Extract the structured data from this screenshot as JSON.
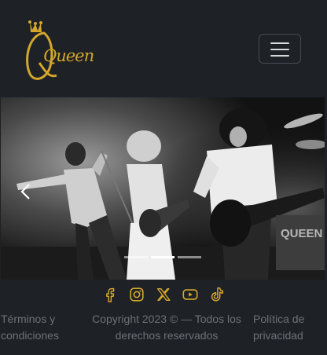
{
  "brand": {
    "logo_text": "Queen",
    "logo_color": "#d4a72c"
  },
  "navbar": {
    "toggler_icon": "hamburger-icon"
  },
  "carousel": {
    "slide_count": 3,
    "active_index": 1,
    "prev_icon": "chevron-left-icon",
    "stage_text": "QUEEN"
  },
  "social": [
    {
      "name": "facebook",
      "icon": "facebook-icon"
    },
    {
      "name": "instagram",
      "icon": "instagram-icon"
    },
    {
      "name": "x",
      "icon": "x-icon"
    },
    {
      "name": "youtube",
      "icon": "youtube-icon"
    },
    {
      "name": "tiktok",
      "icon": "tiktok-icon"
    }
  ],
  "footer": {
    "terms": "Términos y condiciones",
    "copyright": "Copyright 2023 © — Todos los derechos reservados",
    "privacy": "Política de privacidad"
  },
  "colors": {
    "background": "#1e2125",
    "accent": "#d4a72c",
    "footer_text": "#6c727a"
  }
}
